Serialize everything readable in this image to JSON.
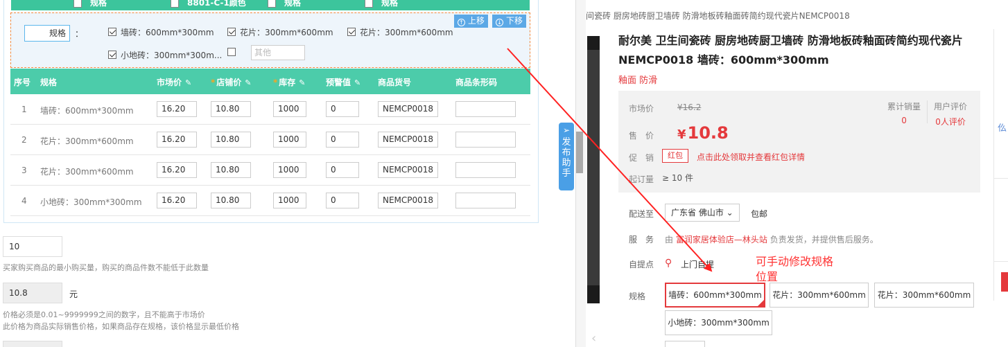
{
  "left": {
    "top_options": [
      {
        "label": "规格",
        "checked": false
      },
      {
        "label": "8801-C-1颜色",
        "checked": false
      },
      {
        "label": "规格",
        "checked": false
      },
      {
        "label": "规格",
        "checked": true
      }
    ],
    "spec_name": "规格",
    "spec_colon": "：",
    "options": [
      {
        "label": "墙砖：600mm*300mm",
        "checked": true
      },
      {
        "label": "花片：300mm*600mm",
        "checked": true
      },
      {
        "label": "花片：300mm*600mm",
        "checked": true
      },
      {
        "label": "小地砖：300mm*300m...",
        "checked": true
      },
      {
        "label": "",
        "checked": false
      }
    ],
    "other_placeholder": "其他",
    "move_up": "上移",
    "move_down": "下移",
    "table": {
      "headers": [
        "序号",
        "规格",
        "市场价",
        "店铺价",
        "库存",
        "预警值",
        "商品货号",
        "商品条形码"
      ],
      "rows": [
        {
          "no": "1",
          "spec": "墙砖：600mm*300mm",
          "market": "16.20",
          "shop": "10.80",
          "stock": "1000",
          "warn": "0",
          "sku": "NEMCP0018",
          "barcode": ""
        },
        {
          "no": "2",
          "spec": "花片：300mm*600mm",
          "market": "16.20",
          "shop": "10.80",
          "stock": "1000",
          "warn": "0",
          "sku": "NEMCP0018",
          "barcode": ""
        },
        {
          "no": "3",
          "spec": "花片：300mm*600mm",
          "market": "16.20",
          "shop": "10.80",
          "stock": "1000",
          "warn": "0",
          "sku": "NEMCP0018",
          "barcode": ""
        },
        {
          "no": "4",
          "spec": "小地砖：300mm*300mm",
          "market": "16.20",
          "shop": "10.80",
          "stock": "1000",
          "warn": "0",
          "sku": "NEMCP0018",
          "barcode": ""
        }
      ]
    },
    "min_buy_value": "10",
    "min_buy_hint": "买家购买商品的最小购买量，购买的商品件数不能低于此数量",
    "price_value": "10.8",
    "price_unit": "元",
    "price_hint1": "价格必须是0.01~9999999之间的数字，且不能高于市场价",
    "price_hint2": "此价格为商品实际销售价格，如果商品存在规格，该价格显示最低价格",
    "publish_helper": [
      "发",
      "布",
      "助",
      "手"
    ]
  },
  "right": {
    "breadcrumb": "间瓷砖 厨房地砖厨卫墙砖 防滑地板砖釉面砖简约现代瓷片NEMCP0018",
    "title": "耐尔美 卫生间瓷砖 厨房地砖厨卫墙砖 防滑地板砖釉面砖简约现代瓷片NEMCP0018 墙砖：600mm*300mm",
    "tags": "釉面 防滑",
    "market_price_label": "市场价",
    "market_price": "¥16.2",
    "sale_price_label": "售　价",
    "currency": "¥",
    "sale_price": "10.8",
    "promo_label": "促　销",
    "promo_badge": "红包",
    "promo_link": "点击此处领取并查看红包详情",
    "moq_label": "起订量",
    "moq_value": "≥ 10 件",
    "sales_label": "累计销量",
    "sales_value": "0",
    "review_label": "用户评价",
    "review_value": "0人评价",
    "ship_label": "配送至",
    "ship_region": "广东省 佛山市",
    "ship_free": "包邮",
    "service_label": "服　务",
    "service_prefix": "由",
    "service_store": "富润家居体验店—林头站",
    "service_suffix": "负责发货，并提供售后服务。",
    "pickup_label": "自提点",
    "pickup_value": "上门自提",
    "spec_label": "规格",
    "spec_options": [
      "墙砖：600mm*300mm",
      "花片：300mm*600mm",
      "花片：300mm*600mm",
      "小地砖：300mm*300mm"
    ],
    "sidebar_text": "仫"
  },
  "annotation": {
    "line1": "可手动修改规格",
    "line2": "位置",
    "color": "#ff3333"
  }
}
